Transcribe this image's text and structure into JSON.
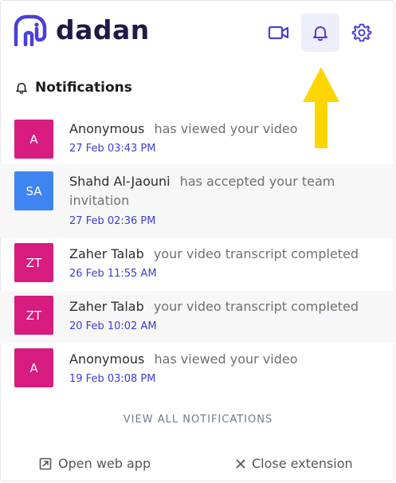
{
  "header": {
    "logo_text": "dadan",
    "icons": {
      "video": "video-camera-icon",
      "bell": "bell-icon",
      "settings": "gear-icon"
    }
  },
  "notifications": {
    "title": "Notifications",
    "items": [
      {
        "initials": "A",
        "avatar_color": "#d81b7f",
        "name": "Anonymous",
        "action": "has viewed your video",
        "time": "27 Feb 03:43 PM"
      },
      {
        "initials": "SA",
        "avatar_color": "#3f85f2",
        "name": "Shahd Al-Jaouni",
        "action": "has accepted your team invitation",
        "time": "27 Feb 02:36 PM"
      },
      {
        "initials": "ZT",
        "avatar_color": "#d81b7f",
        "name": "Zaher Talab",
        "action": "your video transcript completed",
        "time": "26 Feb 11:55 AM"
      },
      {
        "initials": "ZT",
        "avatar_color": "#d81b7f",
        "name": "Zaher Talab",
        "action": "your video transcript completed",
        "time": "20 Feb 10:02 AM"
      },
      {
        "initials": "A",
        "avatar_color": "#d81b7f",
        "name": "Anonymous",
        "action": "has viewed your video",
        "time": "19 Feb 03:08 PM"
      }
    ],
    "view_all_label": "VIEW ALL NOTIFICATIONS"
  },
  "footer": {
    "open_web_app": "Open web app",
    "close_extension": "Close extension"
  },
  "colors": {
    "brand": "#4a3fd9",
    "time_text": "#3d3cd6",
    "annotation_arrow": "#ffd500"
  }
}
